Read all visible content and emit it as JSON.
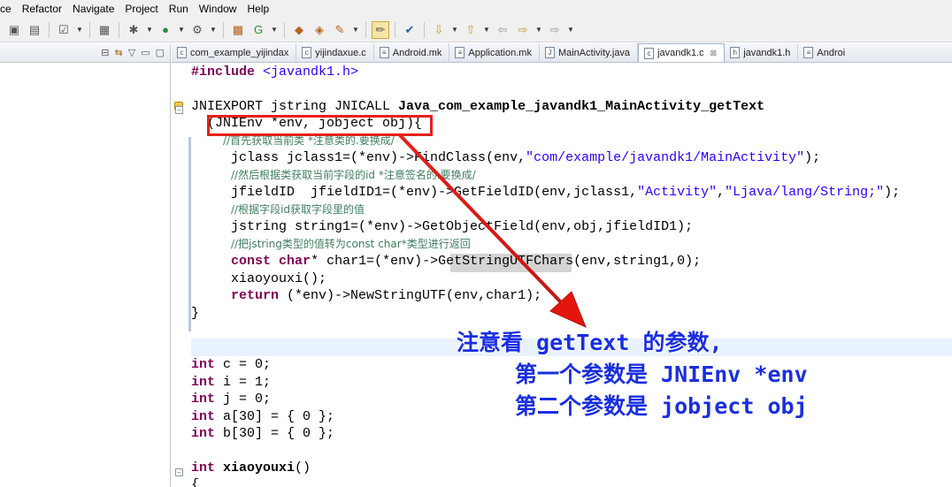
{
  "menu": [
    "ce",
    "Refactor",
    "Navigate",
    "Project",
    "Run",
    "Window",
    "Help"
  ],
  "toolbar_icons": [
    "save-all-icon",
    "print-icon",
    "checkbox-icon",
    "new-icon",
    "debug-icon",
    "run-icon",
    "external-tools-icon",
    "new-class-icon",
    "new-package-icon",
    "open-type-icon",
    "open-resource-icon",
    "search-icon",
    "highlight-icon",
    "marker-icon",
    "next-annotation-icon",
    "prev-annotation-icon",
    "back-icon",
    "forward-icon"
  ],
  "tabs": [
    {
      "label": "com_example_yijindax",
      "icon": "c-file-icon"
    },
    {
      "label": "yijindaxue.c",
      "icon": "c-file-icon"
    },
    {
      "label": "Android.mk",
      "icon": "makefile-icon"
    },
    {
      "label": "Application.mk",
      "icon": "makefile-icon"
    },
    {
      "label": "MainActivity.java",
      "icon": "java-file-icon"
    },
    {
      "label": "javandk1.c",
      "icon": "c-file-icon",
      "active": true
    },
    {
      "label": "javandk1.h",
      "icon": "h-file-icon"
    },
    {
      "label": "Androi",
      "icon": "makefile-icon"
    }
  ],
  "code": {
    "include_kw": "#include",
    "include_file": " <javandk1.h>",
    "sig_prefix": "JNIEXPORT jstring JNICALL ",
    "sig_func": "Java_com_example_javandk1_MainActivity_getText",
    "params": "  (JNIEnv *env, jobject obj){",
    "c1": "//首先获取当前类 *注意类的.要换成/",
    "l_find_a": "jclass jclass1=(*env)->FindClass(env,",
    "l_find_str": "\"com/example/javandk1/MainActivity\"",
    "l_find_b": ");",
    "c2": "//然后根据类获取当前字段的id *注意签名的.要换成/",
    "l_field_a": "jfieldID  jfieldID1=(*env)->GetFieldID(env,jclass1,",
    "l_field_s1": "\"Activity\"",
    "l_field_comma": ",",
    "l_field_s2": "\"Ljava/lang/String;\"",
    "l_field_b": ");",
    "c3": "//根据字段id获取字段里的值",
    "l_obj": "jstring string1=(*env)->GetObjectField(env,obj,jfieldID1);",
    "c4": "//把jstring类型的值转为const char*类型进行返回",
    "l_const_kw1": "const",
    "l_const_kw2": "char",
    "l_const_b": "* char1=(*env)->GetStringUTFChars(env,string1,0);",
    "l_call": "xiaoyouxi();",
    "l_return_kw": "return",
    "l_return_b": " (*env)->NewStringUTF(env,char1);",
    "close": "}",
    "int_kw": "int",
    "d_c": " c = 0;",
    "d_i": " i = 1;",
    "d_j": " j = 0;",
    "d_a": " a[30] = { 0 };",
    "d_b": " b[30] = { 0 };",
    "fn_name": "xiaoyouxi",
    "fn_paren": "()",
    "last_brace": "{"
  },
  "annotation": {
    "line1": "注意看 getText 的参数,",
    "line2": "第一个参数是 JNIEnv *env",
    "line3": "第二个参数是 jobject obj"
  },
  "colors": {
    "annotation_text": "#1a2fe0",
    "callout": "#e8201a",
    "keyword": "#7f0055",
    "string": "#2a00ff",
    "comment": "#3f7f5f"
  }
}
